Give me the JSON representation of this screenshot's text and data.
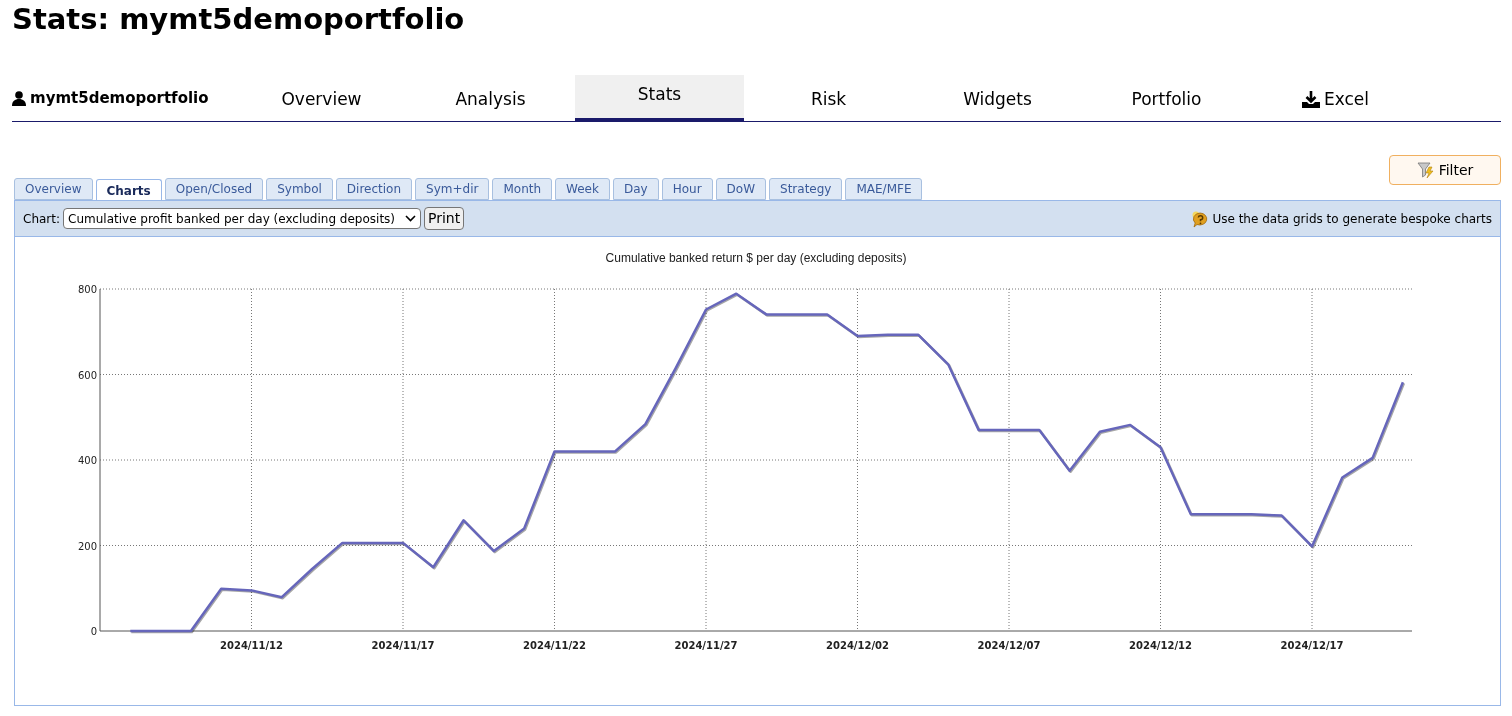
{
  "page_title": "Stats: mymt5demoportfolio",
  "nav": {
    "user": "mymt5demoportfolio",
    "items": [
      {
        "label": "Overview",
        "selected": false,
        "kind": "text"
      },
      {
        "label": "Analysis",
        "selected": false,
        "kind": "text"
      },
      {
        "label": "Stats",
        "selected": true,
        "kind": "text"
      },
      {
        "label": "Risk",
        "selected": false,
        "kind": "text"
      },
      {
        "label": "Widgets",
        "selected": false,
        "kind": "text"
      },
      {
        "label": "Portfolio",
        "selected": false,
        "kind": "text"
      },
      {
        "label": "Excel",
        "selected": false,
        "kind": "download"
      }
    ]
  },
  "filter_button": "Filter",
  "sub_tabs": [
    {
      "label": "Overview",
      "selected": false
    },
    {
      "label": "Charts",
      "selected": true
    },
    {
      "label": "Open/Closed",
      "selected": false
    },
    {
      "label": "Symbol",
      "selected": false
    },
    {
      "label": "Direction",
      "selected": false
    },
    {
      "label": "Sym+dir",
      "selected": false
    },
    {
      "label": "Month",
      "selected": false
    },
    {
      "label": "Week",
      "selected": false
    },
    {
      "label": "Day",
      "selected": false
    },
    {
      "label": "Hour",
      "selected": false
    },
    {
      "label": "DoW",
      "selected": false
    },
    {
      "label": "Strategy",
      "selected": false
    },
    {
      "label": "MAE/MFE",
      "selected": false
    }
  ],
  "toolbar": {
    "chart_label": "Chart:",
    "chart_select": "Cumulative profit banked per day (excluding deposits)",
    "print_button": "Print",
    "hint": "Use the data grids to generate bespoke charts"
  },
  "chart": {
    "chart_data": {
      "type": "line",
      "title": "Cumulative banked return $ per day (excluding deposits)",
      "grid": true,
      "categories": [
        null,
        null,
        null,
        null,
        "2024/11/12",
        null,
        null,
        null,
        null,
        "2024/11/17",
        null,
        null,
        null,
        null,
        "2024/11/22",
        null,
        null,
        null,
        null,
        "2024/11/27",
        null,
        null,
        null,
        null,
        "2024/12/02",
        null,
        null,
        null,
        null,
        "2024/12/07",
        null,
        null,
        null,
        null,
        "2024/12/12",
        null,
        null,
        null,
        null,
        "2024/12/17",
        null,
        null,
        null
      ],
      "series": [
        {
          "color": "#6666bb",
          "values": [
            0,
            0,
            0,
            99,
            95,
            79,
            145,
            206,
            206,
            206,
            149,
            259,
            187,
            240,
            420,
            420,
            420,
            484,
            615,
            752,
            789,
            740,
            740,
            740,
            690,
            693,
            693,
            623,
            470,
            470,
            470,
            375,
            466,
            482,
            430,
            273,
            273,
            273,
            270,
            198,
            359,
            405,
            582
          ]
        }
      ],
      "ylim": [
        0,
        800
      ],
      "yticks": [
        0,
        200,
        400,
        600,
        800
      ]
    }
  }
}
